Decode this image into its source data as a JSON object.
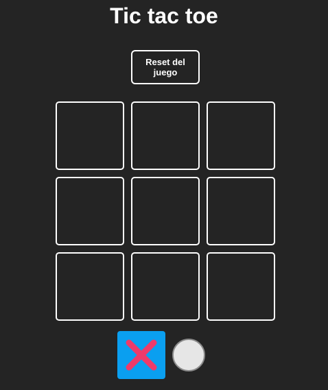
{
  "game": {
    "title": "Tic tac toe",
    "reset_label": "Reset del juego"
  },
  "board": {
    "cells": [
      "",
      "",
      "",
      "",
      "",
      "",
      "",
      "",
      ""
    ]
  },
  "turn": {
    "current_player": "X",
    "players": [
      {
        "symbol": "x-icon",
        "active": true
      },
      {
        "symbol": "o-icon",
        "active": false
      }
    ]
  },
  "colors": {
    "background": "#242424",
    "cell_border": "#ffffff",
    "active_turn_bg": "#0a9ff0",
    "x_mark": "#ee3a6a",
    "o_mark": "#e6e6e6"
  }
}
